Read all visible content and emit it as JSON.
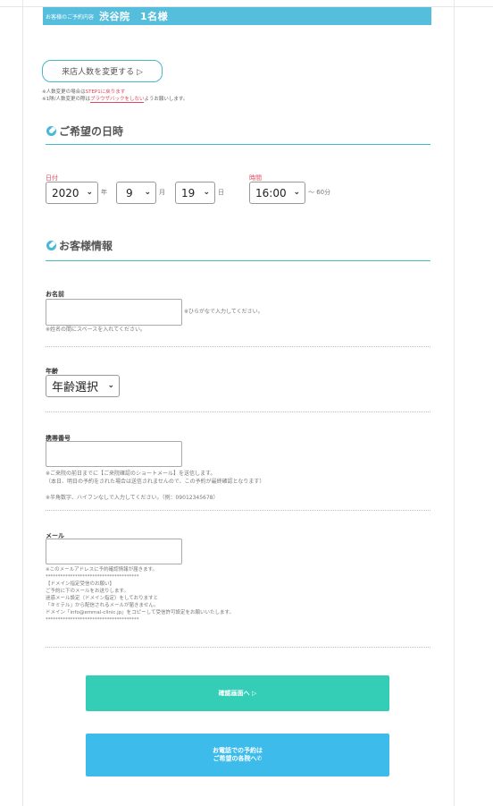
{
  "banner": {
    "small": "お客様のご予約内容",
    "main": "渋谷院　1名様"
  },
  "change_button": {
    "label": "来店人数を変更する ▷"
  },
  "notes": {
    "line1_prefix": "※人数変更の場合は",
    "line1_link": "STEP1に戻ります",
    "line2_prefix": "※1隊/人数変更の際は",
    "line2_link": "ブラウザバックをしない",
    "line2_suffix": "ようお願いします。"
  },
  "datetime_section": {
    "title": "ご希望の日時",
    "date_label": "日付",
    "year": "2020",
    "year_unit": "年",
    "month": "9",
    "month_unit": "月",
    "day": "19",
    "day_unit": "日",
    "time_label": "時間",
    "time": "16:00",
    "duration": "～ 60分"
  },
  "customer_section": {
    "title": "お客様情報",
    "name": {
      "label": "お名前",
      "hint_right": "※ひらがなで入力してください。",
      "hint_below": "※姓名の間にスペースを入れてください。",
      "value": ""
    },
    "age": {
      "label": "年齢",
      "selected": "年齢選択"
    },
    "phone": {
      "label": "携帯番号",
      "value": "",
      "hint": "※ご来院の前日までに【ご来院確認のショートメール】を送信します。\n（本日、明日の予約をされた場合は送信されませんので、この予約が最終確認となります）\n\n※半角数字、ハイフンなしで入力してください。（例：09012345678）"
    },
    "email": {
      "label": "メール",
      "value": "",
      "hint": "※このメールアドレスに予約確認情報が届きます。\n**************************************\n【ドメイン指定受信のお願い】\nご予約に下のメールをお送りします。\n迷惑メール設定（ドメイン指定）をしておりますと\n「キミテル」から配信されるメールが届きません。\nドメイン「info@emmal-clinic.jp」をコピーして受信許可設定をお願いいたします。\n**************************************"
    }
  },
  "buttons": {
    "confirm": "確認画面へ ▷",
    "phone_line1": "お電話での予約は",
    "phone_line2": "ご希望の各院へ"
  },
  "colors": {
    "banner": "#56bedd",
    "accent": "#49b7c8",
    "confirm": "#34ceb7",
    "phone": "#3dbcec",
    "warning": "#e0485e"
  }
}
